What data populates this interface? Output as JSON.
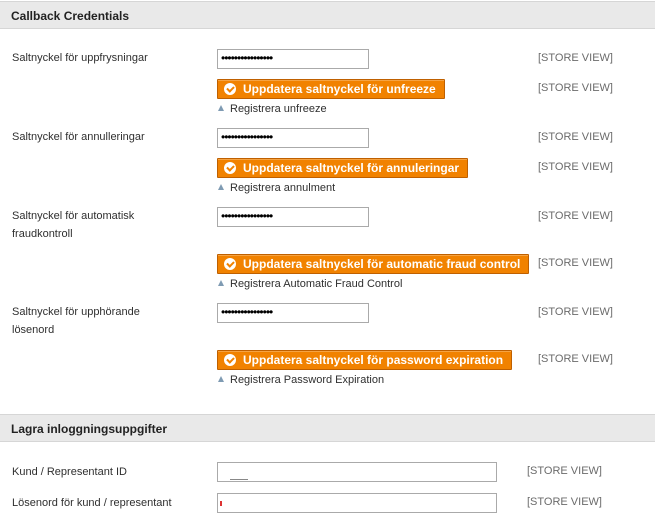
{
  "section1": {
    "title": "Callback Credentials"
  },
  "rows": [
    {
      "label": "Saltnyckel för uppfrysningar",
      "password": "••••••••••••••••",
      "scope": "[STORE VIEW]",
      "button": "Uppdatera saltnyckel för unfreeze",
      "button_scope": "[STORE VIEW]",
      "link": "Registrera unfreeze"
    },
    {
      "label": "Saltnyckel för annulleringar",
      "password": "••••••••••••••••",
      "scope": "[STORE VIEW]",
      "button": "Uppdatera saltnyckel för annuleringar",
      "button_scope": "[STORE VIEW]",
      "link": "Registrera annulment"
    },
    {
      "label": "Saltnyckel för automatisk fraudkontroll",
      "password": "••••••••••••••••",
      "scope": "[STORE VIEW]",
      "button": "Uppdatera saltnyckel för automatic fraud control",
      "button_scope": "[STORE VIEW]",
      "link": "Registrera Automatic Fraud Control"
    },
    {
      "label": "Saltnyckel för upphörande lösenord",
      "password": "••••••••••••••••",
      "scope": "[STORE VIEW]",
      "button": "Uppdatera saltnyckel för password expiration",
      "button_scope": "[STORE VIEW]",
      "link": "Registrera Password Expiration"
    }
  ],
  "section2": {
    "title": "Lagra inloggningsuppgifter"
  },
  "fields": [
    {
      "label": "Kund / Representant ID",
      "value": "",
      "scope": "[STORE VIEW]"
    },
    {
      "label": "Lösenord för kund / representant",
      "value": "",
      "scope": "[STORE VIEW]"
    }
  ]
}
